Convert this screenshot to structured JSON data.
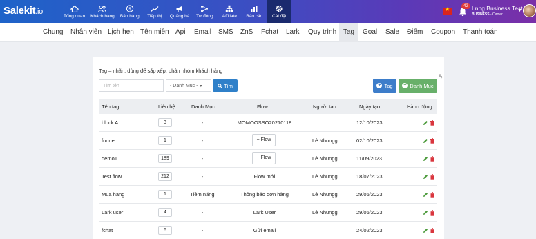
{
  "app": {
    "logo": "Salekit",
    "logo_suffix": ".io"
  },
  "nav": [
    {
      "label": "Tổng quan",
      "icon": "home-icon"
    },
    {
      "label": "Khách hàng",
      "icon": "users-icon"
    },
    {
      "label": "Bán hàng",
      "icon": "dollar-icon"
    },
    {
      "label": "Tiếp thị",
      "icon": "chart-line-icon"
    },
    {
      "label": "Quảng bá",
      "icon": "megaphone-icon"
    },
    {
      "label": "Tự động",
      "icon": "automation-icon"
    },
    {
      "label": "Affiliate",
      "icon": "network-icon"
    },
    {
      "label": "Báo cáo",
      "icon": "bar-chart-icon"
    },
    {
      "label": "Cài đặt",
      "icon": "gear-icon",
      "active": true
    }
  ],
  "user": {
    "name": "Lnhg Business Test",
    "plan": "BUSINESS",
    "role": "- Owner",
    "notifications": "42"
  },
  "subtabs": [
    "Chung",
    "Nhân viên",
    "Lịch hẹn",
    "Tên miền",
    "Api",
    "Email",
    "SMS",
    "ZnS",
    "Fchat",
    "Lark",
    "Quy trình",
    "Tag",
    "Goal",
    "Sale",
    "Điểm",
    "Coupon",
    "Thanh toán"
  ],
  "active_subtab": "Tag",
  "page": {
    "description": "Tag – nhãn: dùng để sắp xếp, phân nhóm khách hàng",
    "search_placeholder": "Tìm tên",
    "category_select": "- Danh Mục -",
    "find_button": "Tìm",
    "add_tag_button": "Tag",
    "add_category_button": "Danh Mục"
  },
  "table": {
    "headers": [
      "Tên tag",
      "Liên hệ",
      "Danh Mục",
      "Flow",
      "Người tạo",
      "Ngày tạo",
      "Hành động"
    ],
    "rows": [
      {
        "name": "block A",
        "contacts": "3",
        "category": "-",
        "flow": "MOMOOSSO20210118",
        "flow_is_button": false,
        "creator": "",
        "date": "12/10/2023"
      },
      {
        "name": "funnel",
        "contacts": "1",
        "category": "-",
        "flow": "+ Flow",
        "flow_is_button": true,
        "creator": "Lê Nhungg",
        "date": "02/10/2023"
      },
      {
        "name": "demo1",
        "contacts": "189",
        "category": "-",
        "flow": "+ Flow",
        "flow_is_button": true,
        "creator": "Lê Nhungg",
        "date": "11/09/2023"
      },
      {
        "name": "Test flow",
        "contacts": "212",
        "category": "-",
        "flow": "Flow mới",
        "flow_is_button": false,
        "creator": "Lê Nhungg",
        "date": "18/07/2023"
      },
      {
        "name": "Mua hàng",
        "contacts": "1",
        "category": "Tiềm năng",
        "flow": "Thông báo đơn hàng",
        "flow_is_button": false,
        "creator": "Lê Nhungg",
        "date": "29/06/2023"
      },
      {
        "name": "Lark user",
        "contacts": "4",
        "category": "-",
        "flow": "Lark User",
        "flow_is_button": false,
        "creator": "Lê Nhungg",
        "date": "29/06/2023"
      },
      {
        "name": "fchat",
        "contacts": "6",
        "category": "-",
        "flow": "Gửi email",
        "flow_is_button": false,
        "creator": "",
        "date": "24/02/2023"
      }
    ]
  },
  "colors": {
    "edit": "#4a9a3a",
    "delete": "#d9363e",
    "primary": "#2f80c9",
    "success": "#68b06a"
  }
}
